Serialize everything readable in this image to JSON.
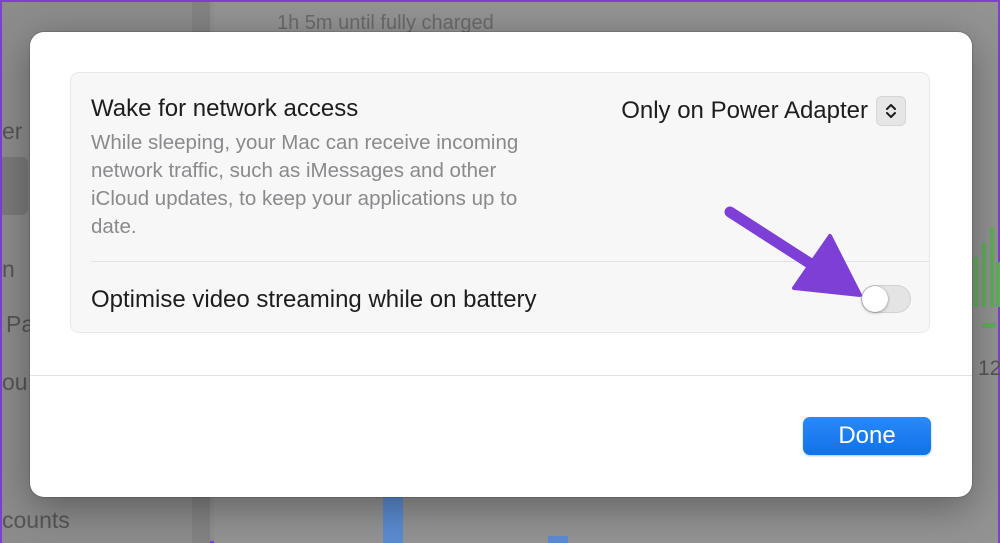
{
  "background": {
    "charging_status": "1h 5m until fully charged",
    "sidebar_fragments": [
      "er",
      "n",
      "Pa",
      "ou",
      "counts"
    ],
    "chart_fragment": "12"
  },
  "sheet": {
    "wake_row": {
      "title": "Wake for network access",
      "description": "While sleeping, your Mac can receive incoming network traffic, such as iMessages and other iCloud updates, to keep your applications up to date.",
      "popup_value": "Only on Power Adapter"
    },
    "video_row": {
      "title": "Optimise video streaming while on battery",
      "toggle_on": false
    },
    "done_label": "Done"
  },
  "colors": {
    "accent": "#1a7ef2",
    "annotation_arrow": "#7d3fd6"
  },
  "icons": {
    "popup_stepper": "chevron-up-down-icon",
    "annotation": "arrow-annotation-icon"
  }
}
